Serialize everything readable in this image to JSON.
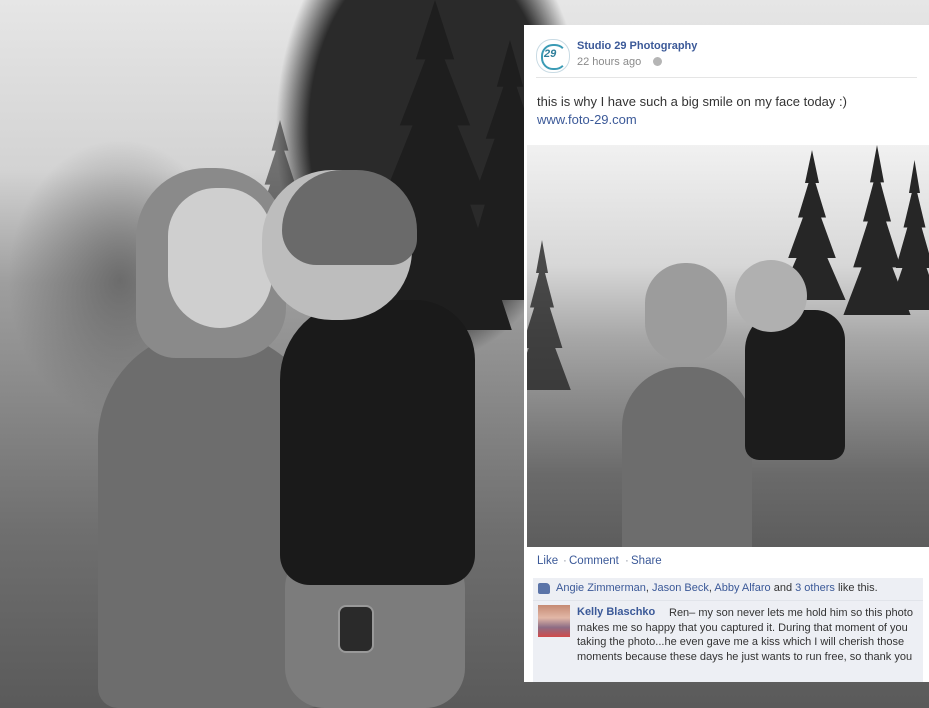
{
  "post": {
    "page_name": "Studio 29 Photography",
    "avatar_text": "29",
    "time": "22 hours ago",
    "text": "this is why I have such a big smile on my face today :)",
    "link": "www.foto-29.com"
  },
  "actions": {
    "like": "Like",
    "comment": "Comment",
    "share": "Share",
    "separator": "·"
  },
  "likes": {
    "people": [
      "Angie Zimmerman",
      "Jason Beck",
      "Abby Alfaro"
    ],
    "and": "and",
    "others": "3 others",
    "suffix": "like this."
  },
  "comment": {
    "author": "Kelly Blaschko",
    "text": "Ren– my son never lets me hold him so this photo makes me so happy that you captured it. During that moment of you taking the photo...he even gave me a kiss which I will cherish those moments because these days he just wants to run free, so thank you"
  },
  "colors": {
    "link_blue": "#3b5998",
    "panel_gray": "#edeff4"
  }
}
